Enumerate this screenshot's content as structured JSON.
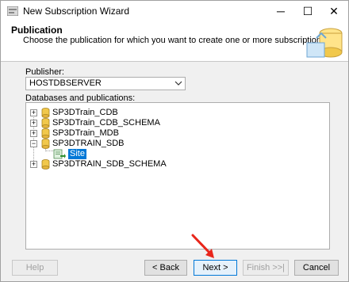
{
  "window": {
    "title": "New Subscription Wizard",
    "controls": {
      "minimize": "─",
      "maximize": "☐",
      "close": "✕"
    }
  },
  "header": {
    "title": "Publication",
    "subtitle": "Choose the publication for which you want to create one or more subscriptions."
  },
  "publisher": {
    "label": "Publisher:",
    "selected": "HOSTDBSERVER"
  },
  "databases": {
    "label": "Databases and publications:",
    "items": [
      {
        "label": "SP3DTrain_CDB",
        "expanded": false
      },
      {
        "label": "SP3DTrain_CDB_SCHEMA",
        "expanded": false
      },
      {
        "label": "SP3DTrain_MDB",
        "expanded": false
      },
      {
        "label": "SP3DTRAIN_SDB",
        "expanded": true,
        "children": [
          {
            "label": "Site",
            "selected": true
          }
        ]
      },
      {
        "label": "SP3DTRAIN_SDB_SCHEMA",
        "expanded": false
      }
    ]
  },
  "buttons": {
    "help": "Help",
    "back": "< Back",
    "next": "Next >",
    "finish": "Finish >>|",
    "cancel": "Cancel"
  },
  "colors": {
    "selection": "#0078d7",
    "annotation_arrow": "#e8261b"
  }
}
